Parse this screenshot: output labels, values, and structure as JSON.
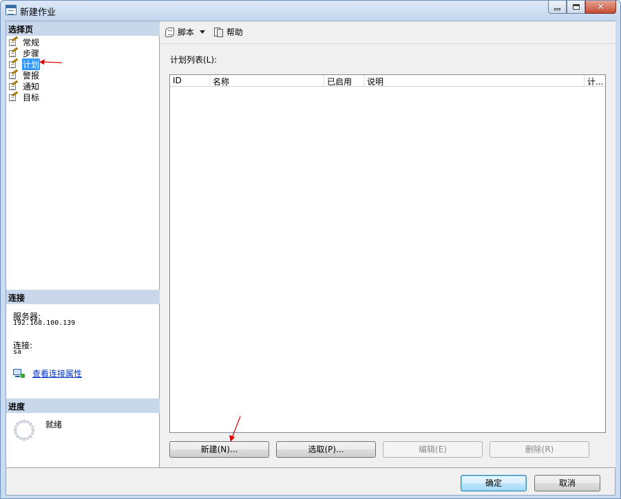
{
  "window": {
    "title": "新建作业"
  },
  "left": {
    "select_page_header": "选择页",
    "nav_items": [
      {
        "label": "常规"
      },
      {
        "label": "步骤"
      },
      {
        "label": "计划"
      },
      {
        "label": "警报"
      },
      {
        "label": "通知"
      },
      {
        "label": "目标"
      }
    ],
    "selected_index": 2,
    "connection_header": "连接",
    "server_label": "服务器:",
    "server_value": "192.168.100.139",
    "connection_label": "连接:",
    "connection_value": "sa",
    "view_props_link": "查看连接属性",
    "progress_header": "进度",
    "progress_status": "就绪"
  },
  "toolbar": {
    "script_label": "脚本",
    "help_label": "帮助"
  },
  "main": {
    "list_label": "计划列表(L):",
    "columns": [
      "ID",
      "名称",
      "已启用",
      "说明",
      "计..."
    ],
    "buttons": {
      "new": "新建(N)...",
      "pick": "选取(P)...",
      "edit": "编辑(E)",
      "delete": "删除(R)"
    }
  },
  "footer": {
    "ok": "确定",
    "cancel": "取消"
  },
  "colors": {
    "selection": "#3399ff",
    "section_header": "#c8d8ea",
    "link": "#0033cc",
    "annotation_arrow": "#e00000"
  }
}
